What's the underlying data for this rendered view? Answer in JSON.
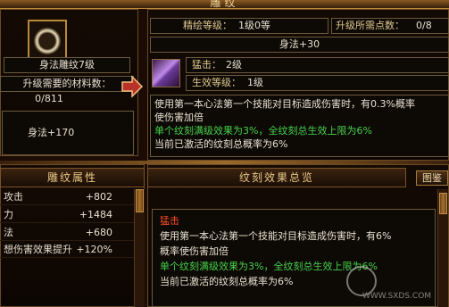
{
  "window": {
    "title": "雕纹"
  },
  "left": {
    "item_name": "身法雕纹7级",
    "material_label": "升级需要的材料数：",
    "material_value": "0/811",
    "stat": "身法+170"
  },
  "upgrade": {
    "level_label": "精绘等级：",
    "level_value": "1级0等",
    "points_label": "升级所需点数：",
    "points_value": "0/8",
    "bonus": "身法+30"
  },
  "skill": {
    "name_label": "猛击：",
    "name_value": "2级",
    "effect_label": "生效等级：",
    "effect_value": "1级",
    "desc_line1": "使用第一本心法第一个技能对目标造成伤害时，有0.3%概率",
    "desc_line2": "使伤害加倍",
    "desc_line3": "单个纹刻满级效果为3%，全纹刻总生效上限为6%",
    "desc_line4": "当前已激活的纹刻总概率为6%"
  },
  "attr_panel": {
    "title": "雕纹属性",
    "rows": [
      {
        "name": "攻击",
        "value": "+802"
      },
      {
        "name": "力",
        "value": "+1484"
      },
      {
        "name": "法",
        "value": "+680"
      },
      {
        "name": "想伤害效果提升",
        "value": "+120%"
      }
    ]
  },
  "overview": {
    "title": "纹刻效果总览",
    "side_button": "图鉴",
    "skill_name": "猛击",
    "line1": "使用第一本心法第一个技能对目标造成伤害时，有6%",
    "line2": "概率使伤害加倍",
    "line3": "单个纹刻满级效果为3%，全纹刻总生效上限为6%",
    "line4": "当前已激活的纹刻总概率为6%"
  },
  "watermark": {
    "text": "WWW.SXDS.COM"
  },
  "colors": {
    "accent": "#c0883a",
    "green": "#46d24a",
    "red": "#ff4a2a"
  }
}
